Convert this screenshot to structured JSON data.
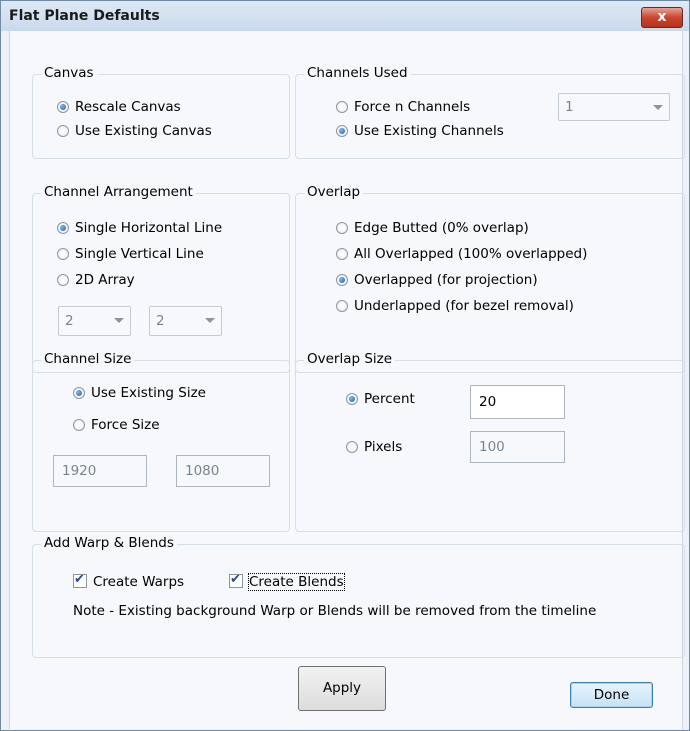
{
  "window": {
    "title": "Flat Plane Defaults",
    "close_glyph": "x"
  },
  "canvas": {
    "legend": "Canvas",
    "options": [
      "Rescale Canvas",
      "Use Existing Canvas"
    ],
    "selected": 0
  },
  "channels_used": {
    "legend": "Channels Used",
    "options": [
      "Force n Channels",
      "Use Existing Channels"
    ],
    "selected": 1,
    "count_value": "1"
  },
  "channel_arrangement": {
    "legend": "Channel Arrangement",
    "options": [
      "Single Horizontal Line",
      "Single Vertical Line",
      "2D Array"
    ],
    "selected": 0,
    "rows_value": "2",
    "cols_value": "2"
  },
  "overlap": {
    "legend": "Overlap",
    "options": [
      "Edge Butted (0% overlap)",
      "All Overlapped (100% overlapped)",
      "Overlapped (for projection)",
      "Underlapped (for bezel removal)"
    ],
    "selected": 2
  },
  "channel_size": {
    "legend": "Channel Size",
    "options": [
      "Use Existing Size",
      "Force Size"
    ],
    "selected": 0,
    "width_value": "1920",
    "height_value": "1080"
  },
  "overlap_size": {
    "legend": "Overlap Size",
    "percent_label": "Percent",
    "percent_value": "20",
    "pixels_label": "Pixels",
    "pixels_value": "100",
    "selected": "percent"
  },
  "warp_blends": {
    "legend": "Add Warp & Blends",
    "create_warps_label": "Create Warps",
    "create_warps_checked": true,
    "create_blends_label": "Create Blends",
    "create_blends_checked": true,
    "note": "Note - Existing background Warp or Blends will be removed from the timeline"
  },
  "buttons": {
    "apply": "Apply",
    "done": "Done"
  }
}
